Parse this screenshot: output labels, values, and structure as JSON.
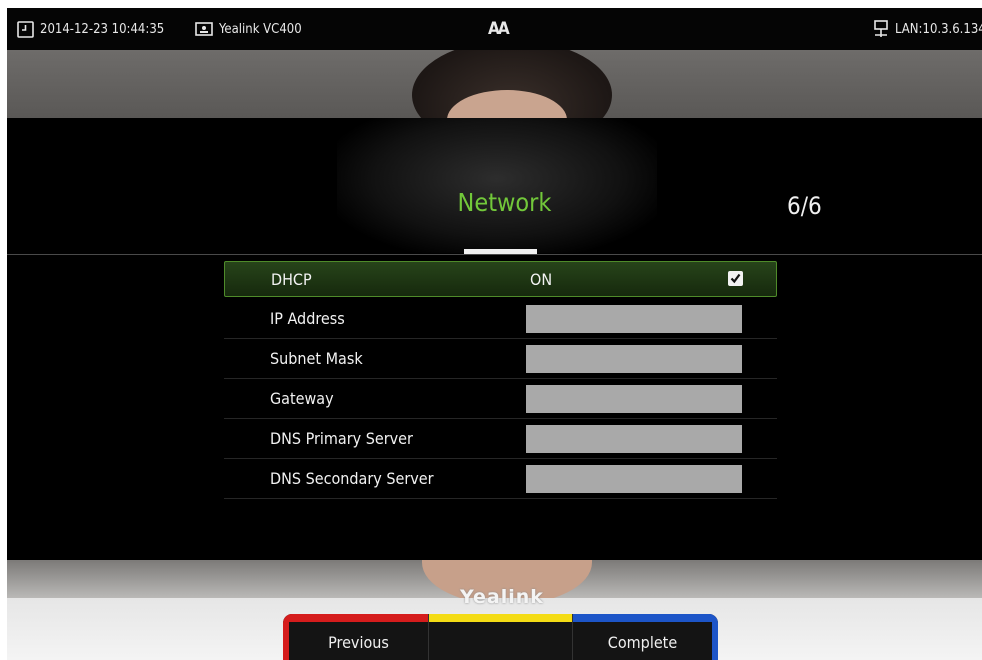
{
  "status_bar": {
    "datetime": "2014-12-23 10:44:35",
    "model": "Yealink VC400",
    "font_size_label": "AA",
    "lan": "LAN:10.3.6.134",
    "icons": [
      "clock-icon",
      "display-icon",
      "font-size-icon",
      "network-icon"
    ]
  },
  "wizard": {
    "title": "Network",
    "page": "6/6",
    "title_color": "#72c83a"
  },
  "settings": [
    {
      "label": "DHCP",
      "value": "ON",
      "checked": true
    },
    {
      "label": "IP Address",
      "value": ""
    },
    {
      "label": "Subnet Mask",
      "value": ""
    },
    {
      "label": "Gateway",
      "value": ""
    },
    {
      "label": "DNS Primary Server",
      "value": ""
    },
    {
      "label": "DNS Secondary Server",
      "value": ""
    }
  ],
  "softkeys": [
    {
      "label": "Previous",
      "color": "#d51c1c"
    },
    {
      "label": "",
      "color": "#f4dc15"
    },
    {
      "label": "Complete",
      "color": "#1d55c8"
    }
  ],
  "branding": {
    "logo_text": "Yealink"
  }
}
